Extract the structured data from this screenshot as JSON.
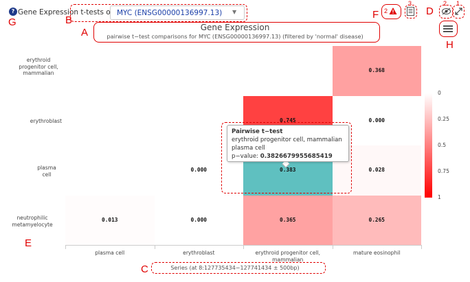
{
  "header": {
    "app_label": "Gene Expression t-tests on",
    "selected_gene": "MYC (ENSG00000136997.13)",
    "help_icon": "?"
  },
  "chart_data": {
    "type": "heatmap",
    "title": "Gene Expression",
    "subtitle": "pairwise t−test comparisons for MYC (ENSG00000136997.13) (filtered by 'normal' disease)",
    "rows": [
      "erythroid progenitor cell, mammalian",
      "erythroblast",
      "plasma cell",
      "neutrophilic metamyelocyte"
    ],
    "columns": [
      "plasma cell",
      "erythroblast",
      "erythroid progenitor cell, mammalian",
      "mature eosinophil"
    ],
    "values": [
      [
        null,
        null,
        null,
        0.368
      ],
      [
        null,
        null,
        0.745,
        0.0
      ],
      [
        null,
        0.0,
        0.383,
        0.028
      ],
      [
        0.013,
        0.0,
        0.365,
        0.265
      ]
    ],
    "value_labels": [
      [
        null,
        null,
        null,
        "0.368"
      ],
      [
        null,
        null,
        "0.745",
        "0.000"
      ],
      [
        null,
        "0.000",
        "0.383",
        "0.028"
      ],
      [
        "0.013",
        "0.000",
        "0.365",
        "0.265"
      ]
    ],
    "highlighted_cell": {
      "row": 2,
      "col": 2,
      "color": "#5fc0c0"
    },
    "colorscale": {
      "min_color": "#ffffff",
      "max_color": "#ff0000",
      "ticks": [
        "0",
        "0.25",
        "0.5",
        "0.75",
        "1"
      ]
    },
    "xlabel": "Series (at 8:127735434−127741434 ± 500bp)"
  },
  "tooltip": {
    "title": "Pairwise t−test",
    "line1": "erythroid progenitor cell, mammalian",
    "line2": "plasma cell",
    "pvalue_label": "p−value:",
    "pvalue": "0.3826679955685419"
  },
  "annotations": {
    "A": "A",
    "B": "B",
    "C": "C",
    "D": "D",
    "E": "E",
    "F": "F",
    "G": "G",
    "H": "H",
    "n1": "1",
    "n2": "2",
    "n3": "3"
  },
  "icons": [
    "help-icon",
    "warning-icon",
    "document-icon",
    "eye-icon",
    "expand-icon",
    "menu-icon",
    "chevron-down-icon"
  ],
  "colors": {
    "accent": "#1a3ea8",
    "annotation": "#e00000",
    "highlight": "#5fc0c0"
  }
}
